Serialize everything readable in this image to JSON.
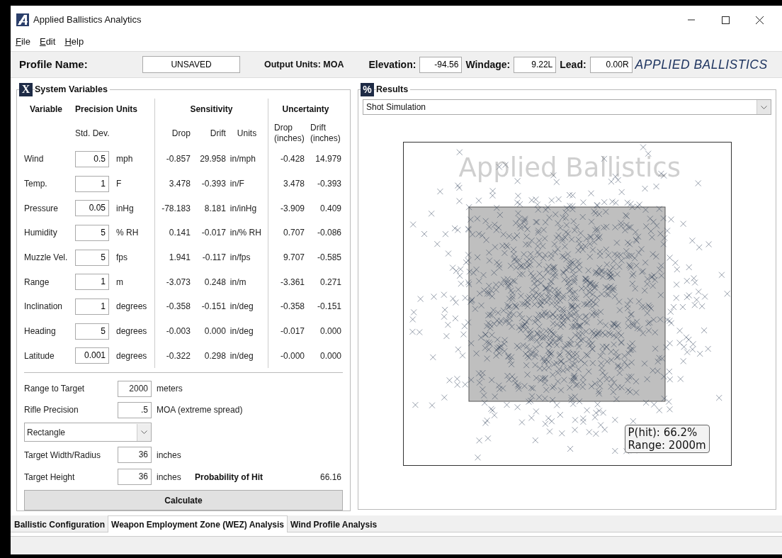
{
  "window": {
    "title": "Applied Ballistics Analytics"
  },
  "menu": [
    "File",
    "Edit",
    "Help"
  ],
  "toolbar": {
    "profile_label": "Profile Name:",
    "profile_value": "UNSAVED",
    "output_units": "Output Units: MOA",
    "fields": [
      {
        "label": "Elevation:",
        "value": "-94.56"
      },
      {
        "label": "Windage:",
        "value": "9.22L"
      },
      {
        "label": "Lead:",
        "value": "0.00R"
      }
    ],
    "brand": "APPLIED BALLISTICS"
  },
  "system_variables": {
    "icon": "X",
    "title": "System Variables",
    "headers": {
      "variable": "Variable",
      "precision": "Precision",
      "units": "Units",
      "sensitivity": "Sensitivity",
      "uncertainty": "Uncertainty",
      "std_dev": "Std. Dev.",
      "drop": "Drop",
      "drift": "Drift",
      "sens_units": "Units",
      "unc_drop": "Drop (inches)",
      "unc_drift": "Drift (inches)"
    },
    "rows": [
      {
        "name": "Wind",
        "std_dev": "0.5",
        "units": "mph",
        "drop": "-0.857",
        "drift": "29.958",
        "sens_units": "in/mph",
        "unc_drop": "-0.428",
        "unc_drift": "14.979"
      },
      {
        "name": "Temp.",
        "std_dev": "1",
        "units": "F",
        "drop": "3.478",
        "drift": "-0.393",
        "sens_units": "in/F",
        "unc_drop": "3.478",
        "unc_drift": "-0.393"
      },
      {
        "name": "Pressure",
        "std_dev": "0.05",
        "units": "inHg",
        "drop": "-78.183",
        "drift": "8.181",
        "sens_units": "in/inHg",
        "unc_drop": "-3.909",
        "unc_drift": "0.409"
      },
      {
        "name": "Humidity",
        "std_dev": "5",
        "units": "% RH",
        "drop": "0.141",
        "drift": "-0.017",
        "sens_units": "in/% RH",
        "unc_drop": "0.707",
        "unc_drift": "-0.086"
      },
      {
        "name": "Muzzle Vel.",
        "std_dev": "5",
        "units": "fps",
        "drop": "1.941",
        "drift": "-0.117",
        "sens_units": "in/fps",
        "unc_drop": "9.707",
        "unc_drift": "-0.585"
      },
      {
        "name": "Range",
        "std_dev": "1",
        "units": "m",
        "drop": "-3.073",
        "drift": "0.248",
        "sens_units": "in/m",
        "unc_drop": "-3.361",
        "unc_drift": "0.271"
      },
      {
        "name": "Inclination",
        "std_dev": "1",
        "units": "degrees",
        "drop": "-0.358",
        "drift": "-0.151",
        "sens_units": "in/deg",
        "unc_drop": "-0.358",
        "unc_drift": "-0.151"
      },
      {
        "name": "Heading",
        "std_dev": "5",
        "units": "degrees",
        "drop": "-0.003",
        "drift": "0.000",
        "sens_units": "in/deg",
        "unc_drop": "-0.017",
        "unc_drift": "0.000"
      },
      {
        "name": "Latitude",
        "std_dev": "0.001",
        "units": "degrees",
        "drop": "-0.322",
        "drift": "0.298",
        "sens_units": "in/deg",
        "unc_drop": "-0.000",
        "unc_drift": "0.000"
      }
    ],
    "target": {
      "range_label": "Range to Target",
      "range_value": "2000",
      "range_unit": "meters",
      "precision_label": "Rifle Precision",
      "precision_value": ".5",
      "precision_unit": "MOA (extreme spread)",
      "shape": "Rectangle",
      "width_label": "Target Width/Radius",
      "width_value": "36",
      "width_unit": "inches",
      "height_label": "Target Height",
      "height_value": "36",
      "height_unit": "inches",
      "probability_label": "Probability of Hit",
      "probability_value": "66.16",
      "calculate": "Calculate"
    }
  },
  "results": {
    "icon": "%",
    "title": "Results",
    "view": "Shot Simulation",
    "plot": {
      "watermark": "Applied Ballistics",
      "legend": [
        "P(hit): 66.2%",
        "Range: 2000m"
      ]
    }
  },
  "tabs": [
    {
      "label": "Ballistic Configuration",
      "selected": false
    },
    {
      "label": "Weapon Employment Zone (WEZ) Analysis",
      "selected": true
    },
    {
      "label": "Wind Profile Analysis",
      "selected": false
    }
  ]
}
